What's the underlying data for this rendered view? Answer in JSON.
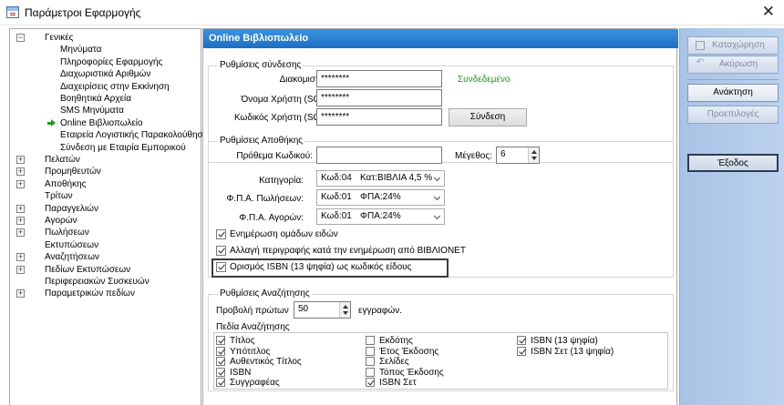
{
  "window": {
    "title": "Παράμετροι Εφαρμογής",
    "close_glyph": "✕"
  },
  "tree": [
    {
      "label": "Γενικές",
      "level": 0,
      "expander": "−"
    },
    {
      "label": "Μηνύματα",
      "level": 1
    },
    {
      "label": "Πληροφορίες Εφαρμογής",
      "level": 1
    },
    {
      "label": "Διαχωριστικά Αριθμών",
      "level": 1
    },
    {
      "label": "Διαχειρίσεις στην Εκκίνηση",
      "level": 1
    },
    {
      "label": "Βοηθητικά Αρχεία",
      "level": 1
    },
    {
      "label": "SMS Μηνύματα",
      "level": 1
    },
    {
      "label": "Online Βιβλιοπωλείο",
      "level": 1,
      "selected": true
    },
    {
      "label": "Εταιρεία Λογιστικής Παρακολούθησης",
      "level": 1
    },
    {
      "label": "Σύνδεση με Εταιρία Εμπορικού",
      "level": 1
    },
    {
      "label": "Πελατών",
      "level": 0,
      "expander": "+"
    },
    {
      "label": "Προμηθευτών",
      "level": 0,
      "expander": "+"
    },
    {
      "label": "Αποθήκης",
      "level": 0,
      "expander": "+"
    },
    {
      "label": "Τρίτων",
      "level": 0
    },
    {
      "label": "Παραγγελιών",
      "level": 0,
      "expander": "+"
    },
    {
      "label": "Αγορών",
      "level": 0,
      "expander": "+"
    },
    {
      "label": "Πωλήσεων",
      "level": 0,
      "expander": "+"
    },
    {
      "label": "Εκτυπώσεων",
      "level": 0
    },
    {
      "label": "Αναζητήσεων",
      "level": 0,
      "expander": "+"
    },
    {
      "label": "Πεδίων Εκτυπώσεων",
      "level": 0,
      "expander": "+"
    },
    {
      "label": "Περιφερειακών Συσκευών",
      "level": 0
    },
    {
      "label": "Παραμετρικών πεδίων",
      "level": 0,
      "expander": "+"
    }
  ],
  "panel": {
    "header": "Online Βιβλιοπωλείο",
    "connection": {
      "title": "Ρυθμίσεις σύνδεσης",
      "server_label": "Διακομιστής:",
      "server_value": "********",
      "status": "Συνδεδεμένο",
      "username_label": "Όνομα Χρήστη (SQL):",
      "username_value": "********",
      "password_label": "Κωδικός Χρήστη (SQL):",
      "password_value": "********",
      "connect_button": "Σύνδεση",
      "status_color": "#1a9a1a"
    },
    "storage": {
      "title": "Ρυθμίσεις Αποθήκης",
      "prefix_label": "Πρόθεμα Κωδικού:",
      "prefix_value": "",
      "size_label": "Μέγεθος:",
      "size_value": "6",
      "category_label": "Κατηγορία:",
      "category_code": "Κωδ:04",
      "category_value": "Κατ:ΒΙΒΛΙΑ 4,5 %",
      "vat_sales_label": "Φ.Π.Α. Πωλήσεων:",
      "vat_sales_code": "Κωδ:01",
      "vat_sales_value": "ΦΠΑ:24%",
      "vat_purchases_label": "Φ.Π.Α. Αγορών:",
      "vat_purchases_code": "Κωδ:01",
      "vat_purchases_value": "ΦΠΑ:24%",
      "options": [
        {
          "label": "Ενημέρωση ομάδων ειδών",
          "checked": true
        },
        {
          "label": "Αλλαγή περιγραφής κατά την ενημέρωση από ΒΙΒΛΙΟΝΕΤ",
          "checked": true
        },
        {
          "label": "Ορισμός ISBN (13 ψηφία) ως κωδικός είδους",
          "checked": true
        }
      ]
    },
    "search": {
      "title": "Ρυθμίσεις Αναζήτησης",
      "show_first_label": "Προβολή πρώτων",
      "show_first_value": "50",
      "records_label": "εγγραφών.",
      "fields_title": "Πεδία Αναζήτησης",
      "fields": [
        {
          "label": "Τίτλος",
          "checked": true
        },
        {
          "label": "Υπότιτλος",
          "checked": true
        },
        {
          "label": "Αυθεντικός Τίτλος",
          "checked": true
        },
        {
          "label": "ISBN",
          "checked": true
        },
        {
          "label": "Συγγραφέας",
          "checked": true
        },
        {
          "label": "Εκδότης",
          "checked": false
        },
        {
          "label": "Έτος Έκδοσης",
          "checked": false
        },
        {
          "label": "Σελίδες",
          "checked": false
        },
        {
          "label": "Τόπος Έκδοσης",
          "checked": false
        },
        {
          "label": "ISBN Σετ",
          "checked": true
        },
        {
          "label": "ISBN (13 ψηφία)",
          "checked": true
        },
        {
          "label": "ISBN Σετ (13 ψηφία)",
          "checked": true
        }
      ]
    }
  },
  "commands": [
    {
      "label": "Καταχώρηση",
      "enabled": false,
      "icon": "save-icon"
    },
    {
      "label": "Ακύρωση",
      "enabled": false,
      "icon": "undo-icon"
    },
    {
      "label": "Ανάκτηση",
      "enabled": true
    },
    {
      "label": "Προεπιλογές",
      "enabled": false
    },
    {
      "label": "Έξοδος",
      "enabled": true,
      "default": true
    }
  ],
  "colors": {
    "header": "#2a82d6",
    "command_bar": "#b3cbea",
    "status_ok": "#1a9a1a",
    "tree_arrow": "#1e9a1e"
  }
}
